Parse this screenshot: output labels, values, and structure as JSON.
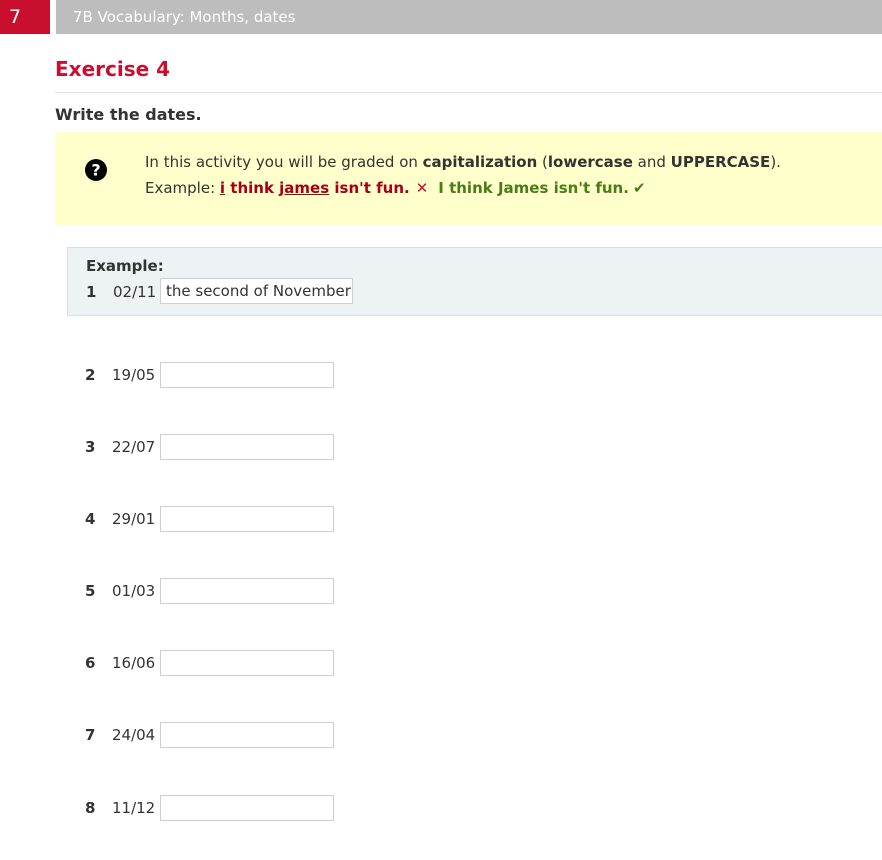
{
  "header": {
    "unit_number": "7",
    "unit_title": "7B Vocabulary: Months, dates"
  },
  "exercise": {
    "title": "Exercise 4",
    "instruction": "Write the dates."
  },
  "note": {
    "line1_prefix": "In this activity you will be graded on ",
    "line1_bold1": "capitalization",
    "line1_mid1": " (",
    "line1_bold2": "lowercase",
    "line1_mid2": " and ",
    "line1_bold3": "UPPERCASE",
    "line1_suffix": ").",
    "line2_prefix": "Example: ",
    "wrong_part1": "i",
    "wrong_part2": " think ",
    "wrong_part3": "james",
    "wrong_part4": " isn't fun.",
    "x_glyph": "✕",
    "right_text": "I think James isn't fun.",
    "check_glyph": "✔"
  },
  "example": {
    "label": "Example:",
    "number": "1",
    "date": "02/11",
    "answer": "the second of November"
  },
  "items": [
    {
      "number": "2",
      "date": "19/05",
      "value": ""
    },
    {
      "number": "3",
      "date": "22/07",
      "value": ""
    },
    {
      "number": "4",
      "date": "29/01",
      "value": ""
    },
    {
      "number": "5",
      "date": "01/03",
      "value": ""
    },
    {
      "number": "6",
      "date": "16/06",
      "value": ""
    },
    {
      "number": "7",
      "date": "24/04",
      "value": ""
    },
    {
      "number": "8",
      "date": "11/12",
      "value": ""
    }
  ],
  "colors": {
    "accent_red": "#c8102e",
    "header_gray": "#bdbdbd",
    "note_bg": "#ffffcc",
    "example_bg": "#edf2f5",
    "correct_green": "#4a7d17"
  },
  "icons": {
    "help": "help-circle-icon",
    "wrong": "cross-icon",
    "correct": "check-icon"
  }
}
